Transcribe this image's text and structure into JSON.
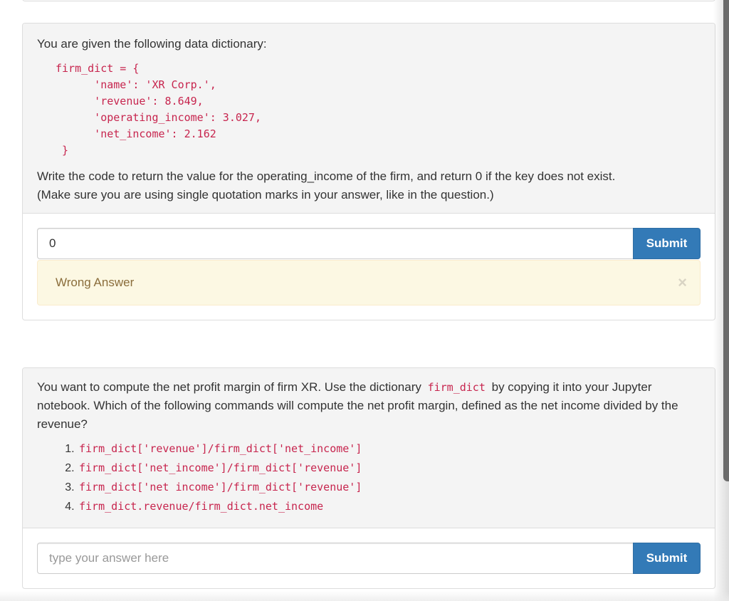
{
  "question1": {
    "intro": "You are given the following data dictionary:",
    "code": "firm_dict = {\n      'name': 'XR Corp.',\n      'revenue': 8.649,\n      'operating_income': 3.027,\n      'net_income': 2.162\n }",
    "prompt_line1": "Write the code to return the value for the operating_income of the firm, and return 0 if the key does not exist.",
    "prompt_line2": "(Make sure you are using single quotation marks in your answer, like in the question.)",
    "answer_value": "0",
    "submit_label": "Submit",
    "feedback": "Wrong Answer",
    "close_glyph": "×"
  },
  "question2": {
    "text_before": "You want to compute the net profit margin of firm XR. Use the dictionary",
    "inline_code": "firm_dict",
    "text_after": "by copying it into your Jupyter notebook. Which of the following commands will compute the net profit margin, defined as the net income divided by the revenue?",
    "options": [
      "firm_dict['revenue']/firm_dict['net_income']",
      "firm_dict['net_income']/firm_dict['revenue']",
      "firm_dict['net income']/firm_dict['revenue']",
      "firm_dict.revenue/firm_dict.net_income"
    ],
    "answer_placeholder": "type your answer here",
    "submit_label": "Submit"
  },
  "colors": {
    "code": "#c7254e",
    "button": "#337ab7",
    "alert_bg": "#fcf8e3",
    "alert_text": "#8a6d3b"
  }
}
